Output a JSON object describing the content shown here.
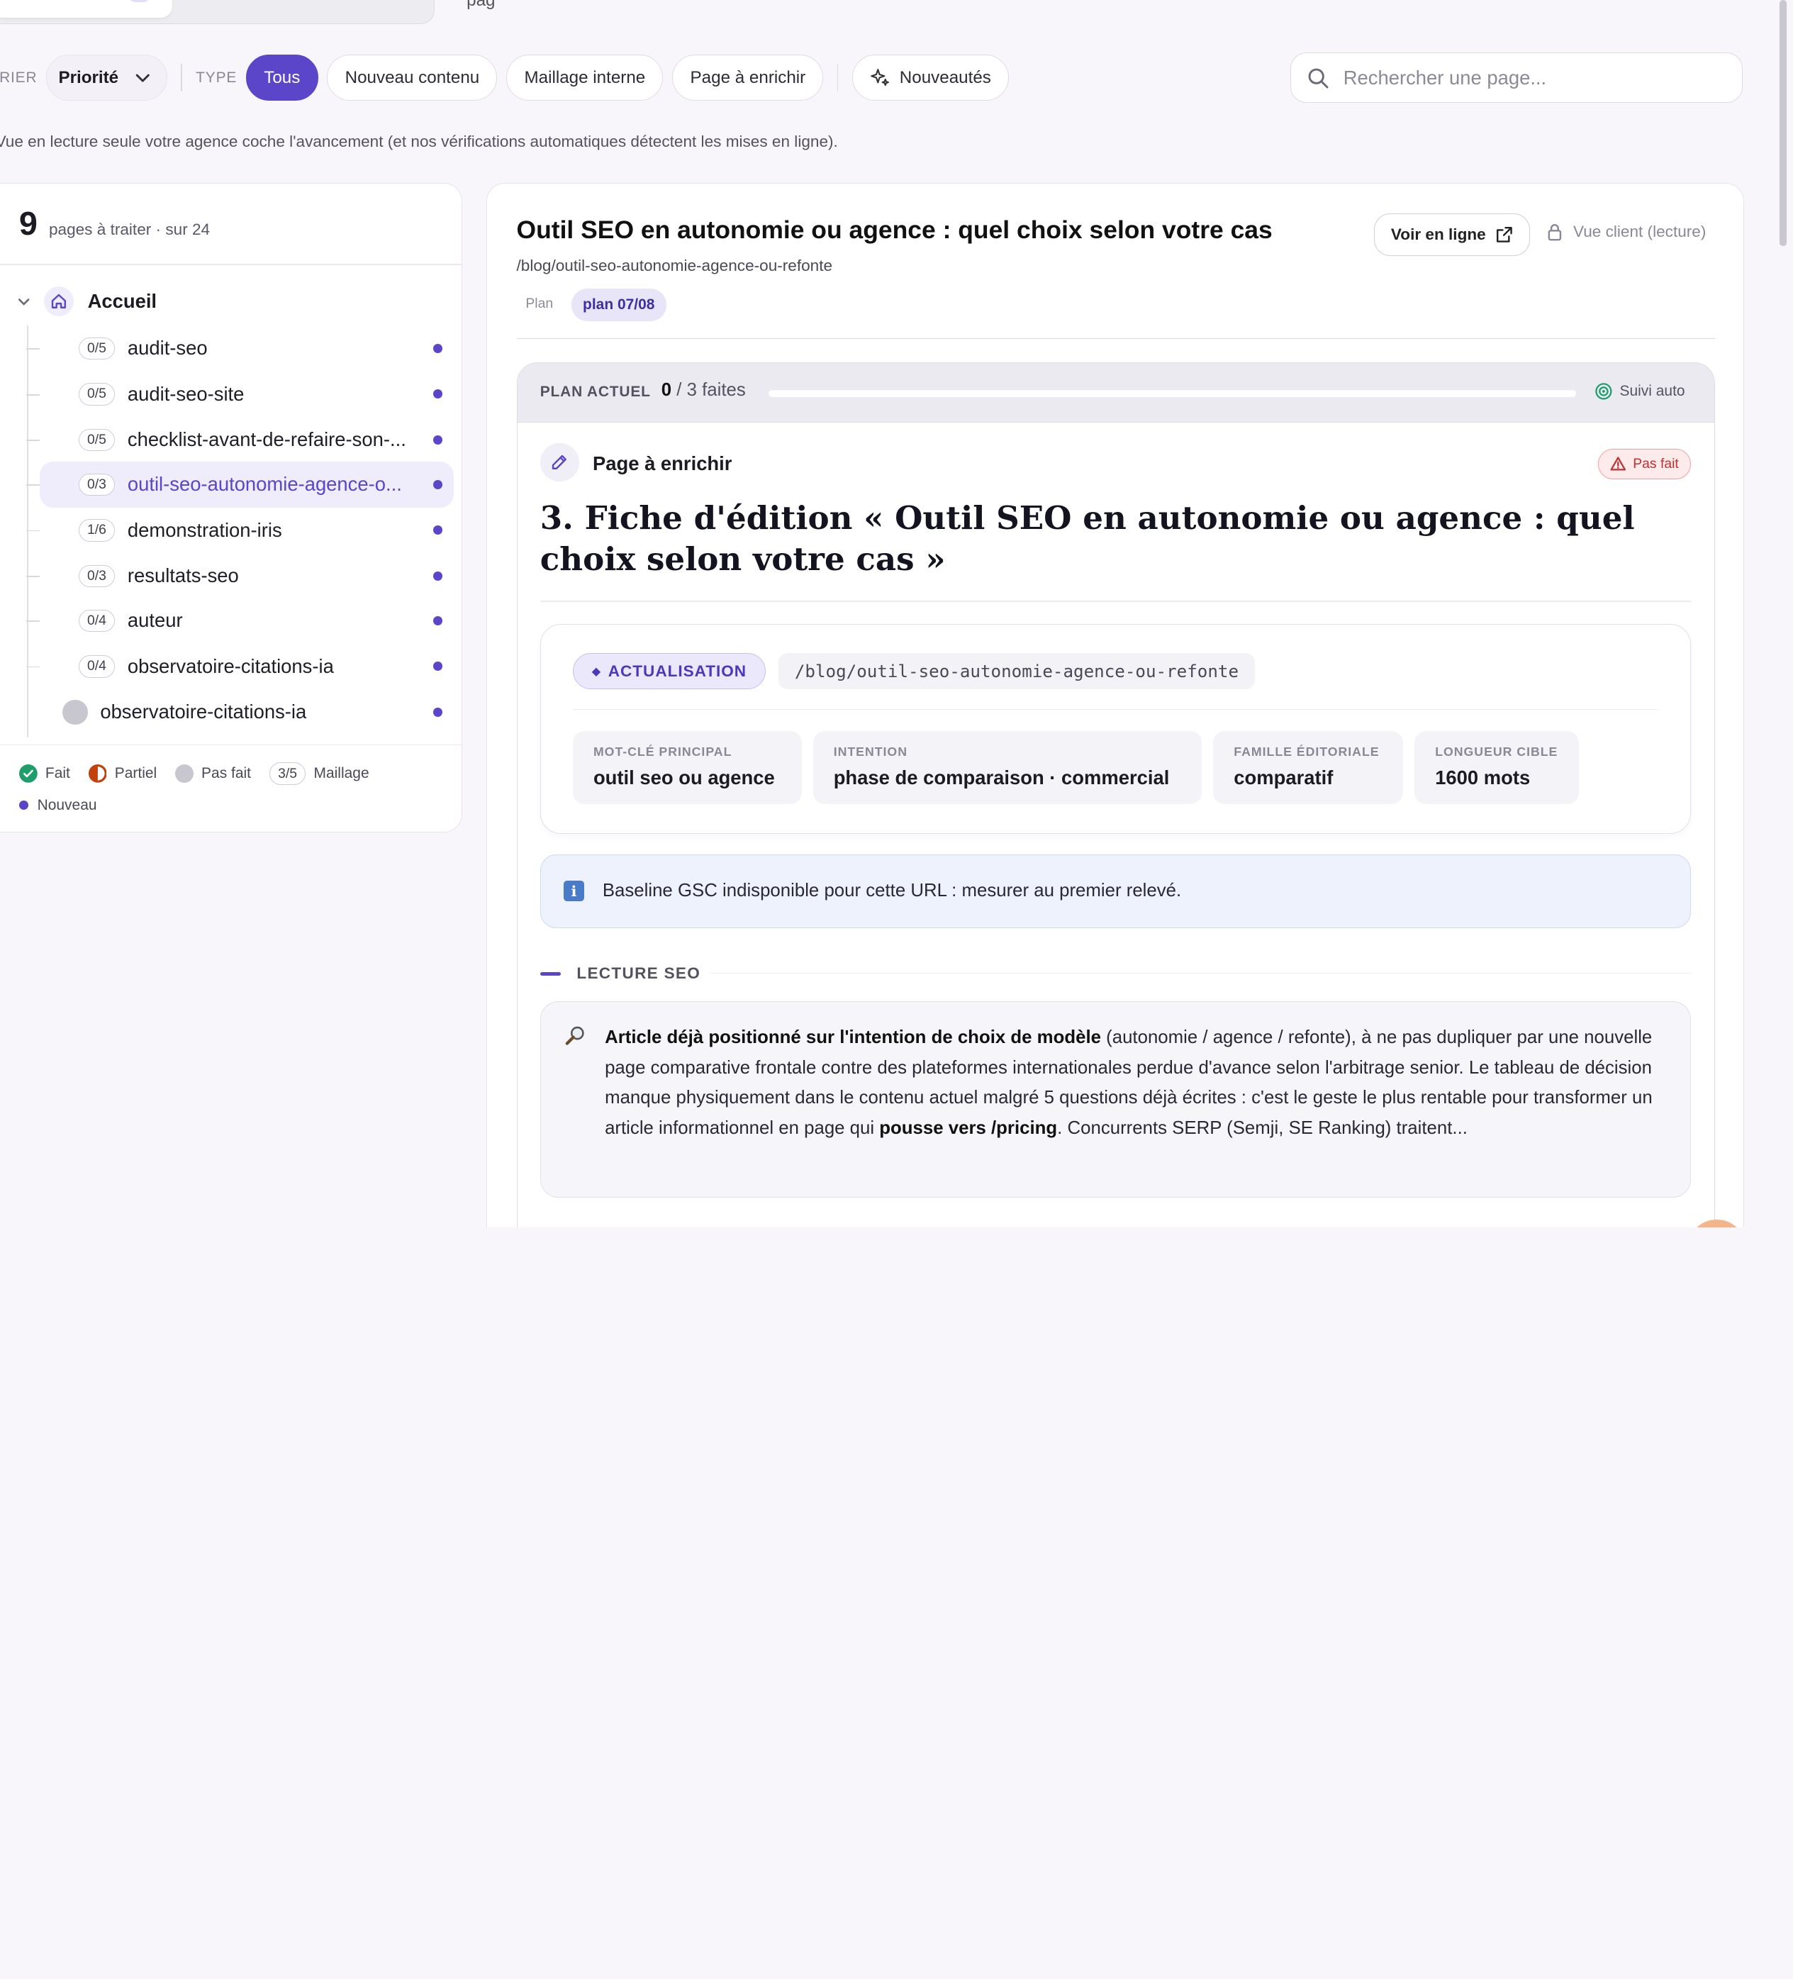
{
  "filters": {
    "sort_label": "TRIER",
    "sort_value": "Priorité",
    "type_label": "TYPE",
    "chips": [
      "Tous",
      "Nouveau contenu",
      "Maillage interne",
      "Page à enrichir"
    ],
    "news_label": "Nouveautés",
    "search_placeholder": "Rechercher une page..."
  },
  "top": {
    "partial_label": "pag"
  },
  "notice": "Vue en lecture seule votre agence coche l'avancement (et nos vérifications automatiques détectent les mises en ligne).",
  "left": {
    "count": "9",
    "count_sub": "pages à traiter · sur 24",
    "root": "Accueil",
    "items": [
      {
        "badge": "0/5",
        "label": "audit-seo"
      },
      {
        "badge": "0/5",
        "label": "audit-seo-site"
      },
      {
        "badge": "0/5",
        "label": "checklist-avant-de-refaire-son-..."
      },
      {
        "badge": "0/3",
        "label": "outil-seo-autonomie-agence-o..."
      },
      {
        "badge": "1/6",
        "label": "demonstration-iris"
      },
      {
        "badge": "0/3",
        "label": "resultats-seo"
      },
      {
        "badge": "0/4",
        "label": "auteur"
      },
      {
        "badge": "0/4",
        "label": "observatoire-citations-ia"
      },
      {
        "badge": "",
        "label": "observatoire-citations-ia"
      }
    ],
    "legend": {
      "fait": "Fait",
      "partiel": "Partiel",
      "pas_fait": "Pas fait",
      "maillage_badge": "3/5",
      "maillage": "Maillage",
      "nouveau": "Nouveau"
    }
  },
  "main": {
    "title": "Outil SEO en autonomie ou agence : quel choix selon votre cas",
    "url": "/blog/outil-seo-autonomie-agence-ou-refonte",
    "plan_label": "Plan",
    "plan_chip": "plan 07/08",
    "voir_en_ligne": "Voir en ligne",
    "vue_client": "Vue client (lecture)",
    "plan_actuel": "PLAN ACTUEL",
    "done_count": "0",
    "done_total": "/ 3 faites",
    "progress": 0,
    "suivi_auto": "Suivi auto",
    "task_type": "Page à enrichir",
    "task_status": "Pas fait",
    "task_heading": "3. Fiche d'édition « Outil SEO en autonomie ou agence : quel choix selon votre cas »",
    "tag": "ACTUALISATION",
    "tag_url": "/blog/outil-seo-autonomie-agence-ou-refonte",
    "fields": [
      {
        "label": "MOT-CLÉ PRINCIPAL",
        "value": "outil seo ou agence"
      },
      {
        "label": "INTENTION",
        "value": "phase de comparaison · commercial"
      },
      {
        "label": "FAMILLE ÉDITORIALE",
        "value": "comparatif"
      },
      {
        "label": "LONGUEUR CIBLE",
        "value": "1600 mots"
      }
    ],
    "info": "Baseline GSC indisponible pour cette URL : mesurer au premier relevé.",
    "section": "LECTURE SEO",
    "seo": {
      "bold1": "Article déjà positionné sur l'intention de choix de modèle",
      "text1": " (autonomie / agence / refonte), à ne pas dupliquer par une nouvelle page comparative frontale contre des plateformes internationales perdue d'avance selon l'arbitrage senior. Le tableau de décision manque physiquement dans le contenu actuel malgré 5 questions déjà écrites : c'est le geste le plus rentable pour transformer un article informationnel en page qui ",
      "bold2": "pousse vers /pricing",
      "text2": ". Concurrents SERP (Semji, SE Ranking) traitent..."
    }
  },
  "colors": {
    "accent": "#5b45c9",
    "done": "#1f9d6b",
    "partial": "#c2410c",
    "todo": "#c8c6cf",
    "danger": "#c23030"
  }
}
